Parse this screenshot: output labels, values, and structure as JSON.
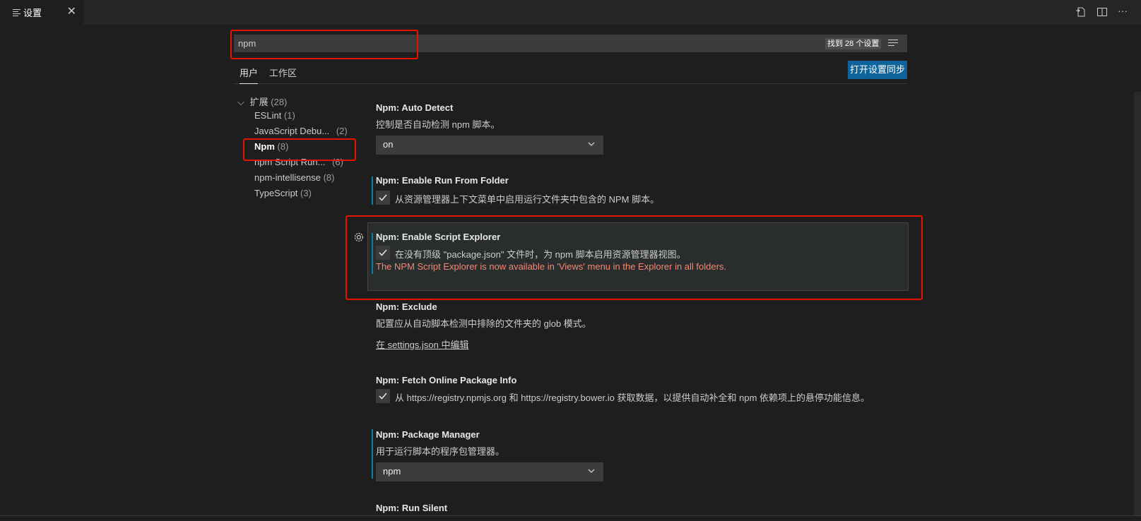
{
  "tab": {
    "title": "设置",
    "close": "✕"
  },
  "toolbar": {
    "icons": [
      "open-settings-json-icon",
      "split-editor-icon",
      "more-actions-icon"
    ],
    "more": "···"
  },
  "search": {
    "value": "npm",
    "result_count": "找到 28 个设置"
  },
  "scope_tabs": {
    "user": "用户",
    "workspace": "工作区"
  },
  "sync_button": "打开设置同步",
  "toc": {
    "root": {
      "label": "扩展",
      "count": "(28)"
    },
    "items": [
      {
        "label": "ESLint",
        "count": "(1)"
      },
      {
        "label": "JavaScript Debu...",
        "count": "(2)"
      },
      {
        "label": "Npm",
        "count": "(8)"
      },
      {
        "label": "npm Script Run...",
        "count": "(6)"
      },
      {
        "label": "npm-intellisense",
        "count": "(8)"
      },
      {
        "label": "TypeScript",
        "count": "(3)"
      }
    ]
  },
  "settings": {
    "auto_detect": {
      "category": "Npm: ",
      "key": "Auto Detect",
      "description": "控制是否自动检测 npm 脚本。",
      "value": "on"
    },
    "run_from_folder": {
      "category": "Npm: ",
      "key": "Enable Run From Folder",
      "label": "从资源管理器上下文菜单中启用运行文件夹中包含的 NPM 脚本。",
      "checked": true
    },
    "script_explorer": {
      "category": "Npm: ",
      "key": "Enable Script Explorer",
      "label": "在没有顶级 \"package.json\" 文件时，为 npm 脚本启用资源管理器视图。",
      "deprecation": "The NPM Script Explorer is now available in 'Views' menu in the Explorer in all folders.",
      "checked": true
    },
    "exclude": {
      "category": "Npm: ",
      "key": "Exclude",
      "description": "配置应从自动脚本检测中排除的文件夹的 glob 模式。",
      "link": "在 settings.json 中编辑"
    },
    "fetch_online": {
      "category": "Npm: ",
      "key": "Fetch Online Package Info",
      "label": "从 https://registry.npmjs.org 和 https://registry.bower.io 获取数据，以提供自动补全和 npm 依赖项上的悬停功能信息。",
      "checked": true
    },
    "package_manager": {
      "category": "Npm: ",
      "key": "Package Manager",
      "description": "用于运行脚本的程序包管理器。",
      "value": "npm"
    },
    "run_silent": {
      "category": "Npm: ",
      "key": "Run Silent"
    }
  },
  "colors": {
    "accent": "#0e639c",
    "highlight": "#e51400",
    "deprecation": "#f48771",
    "modified": "#0c7d9d"
  }
}
